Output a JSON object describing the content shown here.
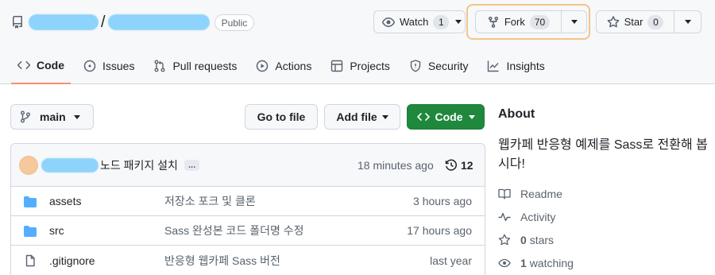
{
  "header": {
    "separator": "/",
    "visibility": "Public"
  },
  "actions": {
    "watch_label": "Watch",
    "watch_count": "1",
    "fork_label": "Fork",
    "fork_count": "70",
    "star_label": "Star",
    "star_count": "0"
  },
  "tabs": [
    {
      "label": "Code",
      "icon": "code-icon",
      "active": true
    },
    {
      "label": "Issues",
      "icon": "issue-icon"
    },
    {
      "label": "Pull requests",
      "icon": "pull-request-icon"
    },
    {
      "label": "Actions",
      "icon": "play-icon"
    },
    {
      "label": "Projects",
      "icon": "table-icon"
    },
    {
      "label": "Security",
      "icon": "shield-icon"
    },
    {
      "label": "Insights",
      "icon": "graph-icon"
    }
  ],
  "toolbar": {
    "branch": "main",
    "go_to_file": "Go to file",
    "add_file": "Add file",
    "code": "Code"
  },
  "commit": {
    "message": "노드 패키지 설치",
    "ellipsis": "...",
    "time": "18 minutes ago",
    "count": "12"
  },
  "files": [
    {
      "type": "folder",
      "name": "assets",
      "message": "저장소 포크 및 클론",
      "time": "3 hours ago"
    },
    {
      "type": "folder",
      "name": "src",
      "message": "Sass 완성본 코드 폴더명 수정",
      "time": "17 hours ago"
    },
    {
      "type": "file",
      "name": ".gitignore",
      "message": "반응형 웹카페 Sass 버전",
      "time": "last year"
    }
  ],
  "about": {
    "title": "About",
    "description": "웹카페 반응형 예제를 Sass로 전환해 봅시다!",
    "readme": "Readme",
    "activity": "Activity",
    "stars_count": "0",
    "stars_label": "stars",
    "watching_count": "1",
    "watching_label": "watching"
  },
  "colors": {
    "code_button": "#1f883d",
    "active_tab_underline": "#fd8c73",
    "fork_highlight": "#f4c58a",
    "redaction": "#8ed3fb"
  }
}
